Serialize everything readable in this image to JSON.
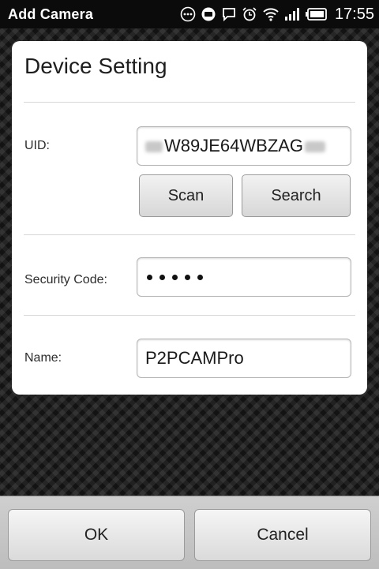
{
  "status_bar": {
    "title": "Add Camera",
    "time": "17:55",
    "icons": [
      "more-icon",
      "chat-bubble-icon",
      "message-icon",
      "alarm-icon",
      "wifi-icon",
      "signal-icon",
      "battery-icon"
    ]
  },
  "dialog": {
    "title": "Device Setting",
    "uid": {
      "label": "UID:",
      "value": "W89JE64WBZAG"
    },
    "scan_label": "Scan",
    "search_label": "Search",
    "security_code": {
      "label": "Security Code:",
      "masked_length": 5
    },
    "name": {
      "label": "Name:",
      "value": "P2PCAMPro"
    }
  },
  "footer": {
    "ok_label": "OK",
    "cancel_label": "Cancel"
  }
}
